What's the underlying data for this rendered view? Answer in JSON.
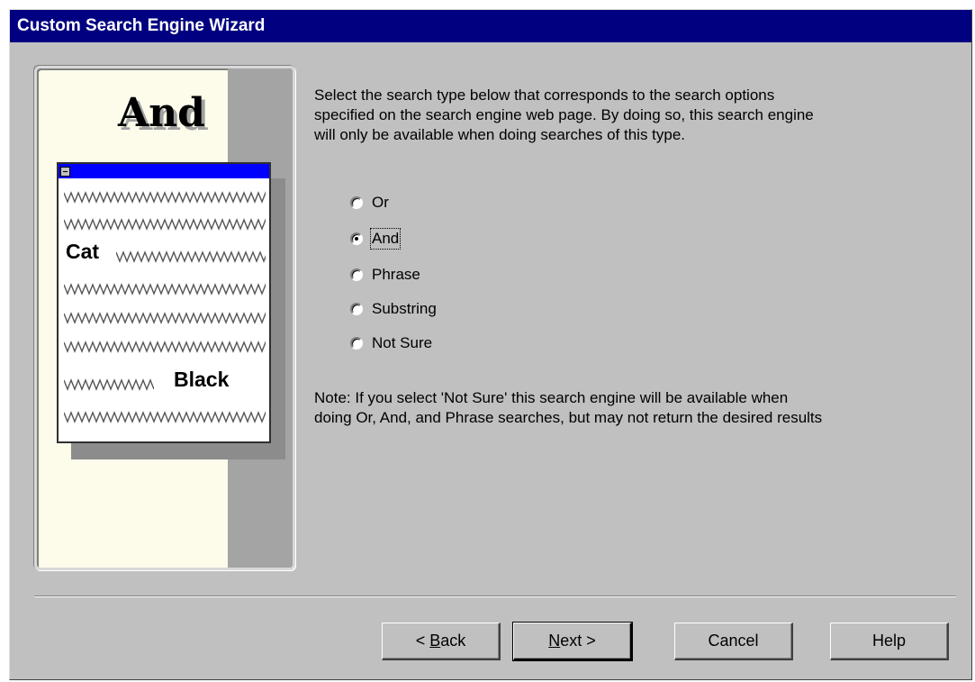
{
  "window": {
    "title": "Custom Search Engine Wizard"
  },
  "illustration": {
    "heading": "And",
    "word_1": "Cat",
    "word_2": "Black"
  },
  "instructions": {
    "line1": "Select the search type below that corresponds to the search options",
    "line2": "specified on the search engine web page. By doing so, this search engine",
    "line3": "will only be available when doing searches of this type."
  },
  "search_types": [
    {
      "label": "Or",
      "selected": false
    },
    {
      "label": "And",
      "selected": true
    },
    {
      "label": "Phrase",
      "selected": false
    },
    {
      "label": "Substring",
      "selected": false
    },
    {
      "label": "Not Sure",
      "selected": false
    }
  ],
  "note": {
    "line1": "Note: If you select 'Not Sure' this search engine will be available when",
    "line2": "doing Or, And, and Phrase searches, but may not return the desired results"
  },
  "buttons": {
    "back_prefix": "< ",
    "back_key": "B",
    "back_rest": "ack",
    "next_key": "N",
    "next_rest": "ext >",
    "cancel": "Cancel",
    "help": "Help"
  }
}
